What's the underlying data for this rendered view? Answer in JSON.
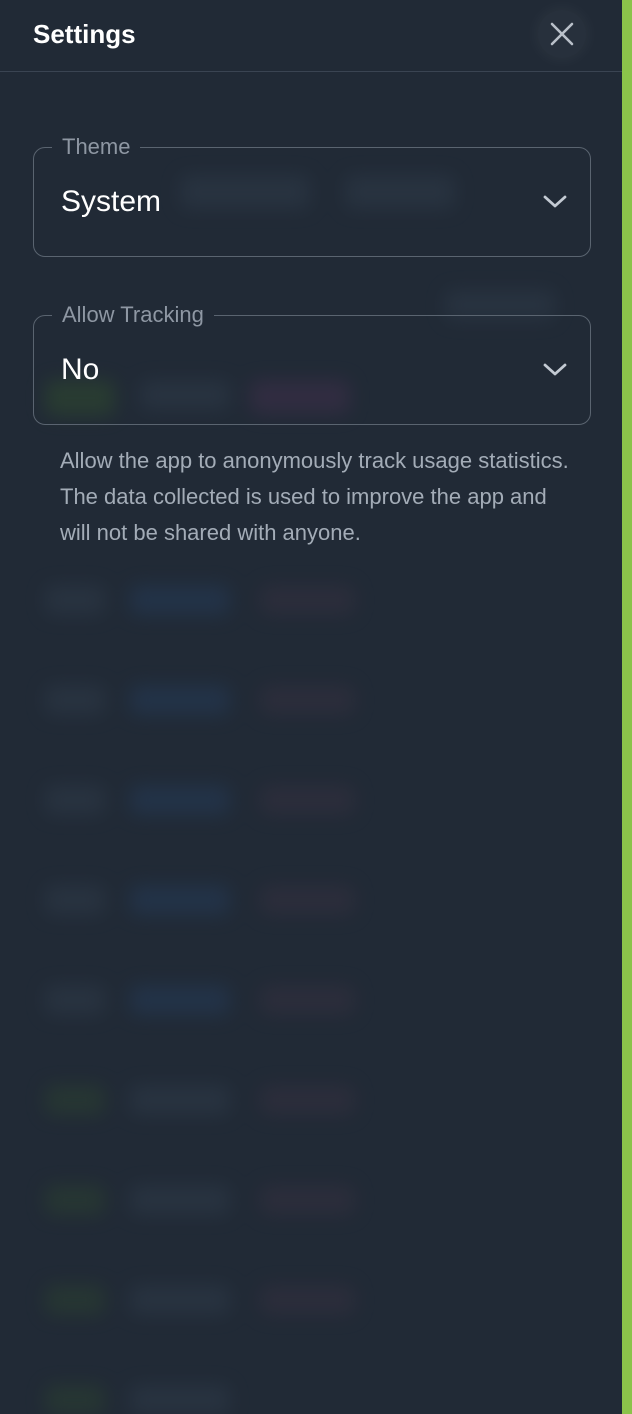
{
  "header": {
    "title": "Settings",
    "close_icon": "close-icon"
  },
  "theme": {
    "label": "Theme",
    "value": "System",
    "icon": "chevron-down-icon"
  },
  "tracking": {
    "label": "Allow Tracking",
    "value": "No",
    "icon": "chevron-down-icon",
    "helper": "Allow the app to anonymously track usage statistics. The data collected is used to improve the app and will not be shared with anyone."
  },
  "colors": {
    "panel": "#212a36",
    "accent": "#8bc34a",
    "text": "#ffffff",
    "muted": "#a3acb7"
  }
}
